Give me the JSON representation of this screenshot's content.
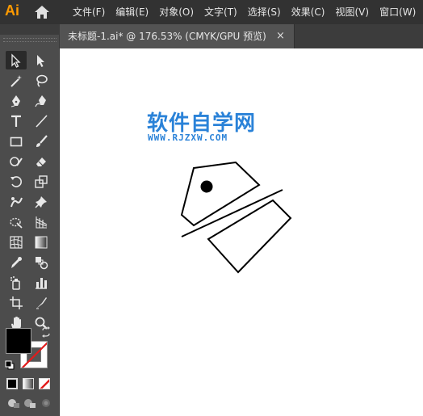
{
  "app": {
    "logo": "Ai"
  },
  "menubar": {
    "items": [
      {
        "label": "文件(F)"
      },
      {
        "label": "编辑(E)"
      },
      {
        "label": "对象(O)"
      },
      {
        "label": "文字(T)"
      },
      {
        "label": "选择(S)"
      },
      {
        "label": "效果(C)"
      },
      {
        "label": "视图(V)"
      },
      {
        "label": "窗口(W)"
      }
    ]
  },
  "panel": {
    "collapse_glyph": "◂◂"
  },
  "document": {
    "tab_title": "未标题-1.ai* @ 176.53% (CMYK/GPU 预览)",
    "close_glyph": "×"
  },
  "watermark": {
    "title": "软件自学网",
    "url": "WWW.RJZXW.COM"
  },
  "colors": {
    "menubar_bg": "#323232",
    "panel_bg": "#4c4c4c",
    "canvas_bg": "#ffffff",
    "logo": "#ff9a00",
    "watermark": "#2a82d8",
    "stroke_none_slash": "#e21b1b"
  },
  "tools": [
    "selection-tool-icon",
    "direct-selection-tool-icon",
    "magic-wand-tool-icon",
    "lasso-tool-icon",
    "pen-tool-icon",
    "curvature-tool-icon",
    "type-tool-icon",
    "line-segment-tool-icon",
    "rectangle-tool-icon",
    "paintbrush-tool-icon",
    "shaper-tool-icon",
    "eraser-tool-icon",
    "rotate-tool-icon",
    "scale-tool-icon",
    "puppet-warp-tool-icon",
    "pin-tool-icon",
    "free-transform-tool-icon",
    "perspective-grid-tool-icon",
    "mesh-tool-icon",
    "gradient-tool-icon",
    "eyedropper-tool-icon",
    "blend-tool-icon",
    "symbol-sprayer-tool-icon",
    "column-graph-tool-icon",
    "artboard-tool-icon",
    "slice-tool-icon",
    "hand-tool-icon",
    "zoom-tool-icon"
  ]
}
